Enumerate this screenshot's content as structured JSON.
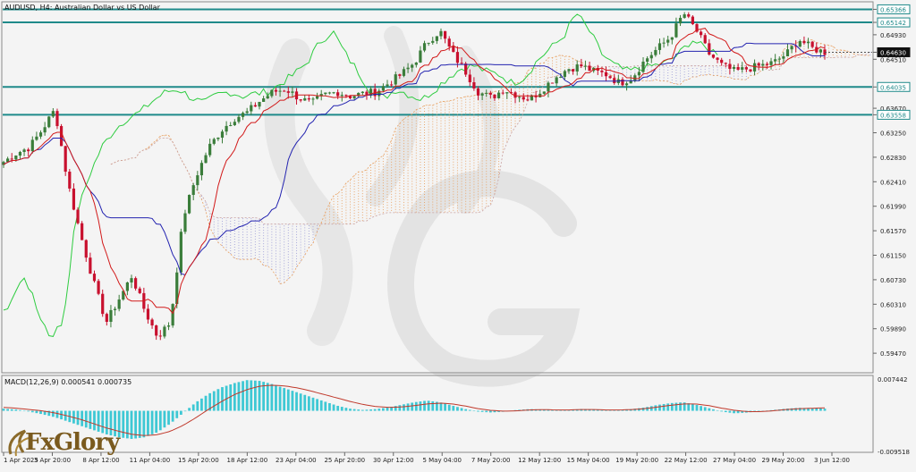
{
  "symbol_title": "AUDUSD, H4:  Australian Dollar vs US Dollar",
  "macd_label": "MACD(12,26,9) 0.000541 0.000735",
  "brand_text": "FxGlory",
  "colors": {
    "background": "#f4f4f4",
    "bull_candle": "#3a7d3a",
    "bear_candle": "#c8102e",
    "tenkan": "#d21a1a",
    "kijun": "#2323b0",
    "chikou": "#2ecc40",
    "cloud_bull": "#e8a060",
    "cloud_bear": "#a0a0d8",
    "level_line": "#1f8a8a",
    "macd_hist": "#3ec8d4",
    "macd_signal": "#c0392b",
    "watermark": "#d9d9d9"
  },
  "chart_data": [
    {
      "type": "candlestick",
      "title": "AUDUSD, H4:  Australian Dollar vs US Dollar",
      "ylim": [
        0.5915,
        0.6548
      ],
      "y_ticks": [
        "0.65366",
        "0.65142",
        "0.64930",
        "0.64630",
        "0.64510",
        "0.64035",
        "0.63670",
        "0.63558",
        "0.63250",
        "0.62830",
        "0.62410",
        "0.61990",
        "0.61570",
        "0.61150",
        "0.60730",
        "0.60310",
        "0.59890",
        "0.59470"
      ],
      "highlighted_ticks": [
        "0.65366",
        "0.65142",
        "0.64630",
        "0.64035",
        "0.63558"
      ],
      "current_price": "0.64630",
      "horizontal_levels": [
        0.65366,
        0.65142,
        0.64035,
        0.63558
      ],
      "x_labels": [
        "1 Apr 2025",
        "3 Apr 20:00",
        "8 Apr 12:00",
        "11 Apr 04:00",
        "15 Apr 20:00",
        "18 Apr 12:00",
        "23 Apr 04:00",
        "25 Apr 20:00",
        "30 Apr 12:00",
        "5 May 04:00",
        "7 May 20:00",
        "12 May 12:00",
        "15 May 04:00",
        "19 May 20:00",
        "22 May 12:00",
        "27 May 04:00",
        "29 May 20:00",
        "3 Jun 12:00"
      ],
      "indicators": [
        "Ichimoku (Tenkan, Kijun, Chikou, Cloud)"
      ],
      "close_path": [
        0.6275,
        0.629,
        0.63,
        0.633,
        0.6365,
        0.624,
        0.615,
        0.607,
        0.6,
        0.604,
        0.608,
        0.602,
        0.5975,
        0.6,
        0.618,
        0.625,
        0.63,
        0.633,
        0.635,
        0.636,
        0.638,
        0.6395,
        0.64,
        0.6385,
        0.6375,
        0.639,
        0.6395,
        0.6388,
        0.6392,
        0.6395,
        0.641,
        0.6425,
        0.6445,
        0.648,
        0.65,
        0.646,
        0.643,
        0.6395,
        0.6385,
        0.64,
        0.639,
        0.6382,
        0.64,
        0.642,
        0.6435,
        0.644,
        0.643,
        0.6425,
        0.641,
        0.642,
        0.645,
        0.647,
        0.649,
        0.653,
        0.65,
        0.646,
        0.644,
        0.643,
        0.6435,
        0.644,
        0.6445,
        0.646,
        0.6485,
        0.647,
        0.6463
      ]
    },
    {
      "type": "bar",
      "title": "MACD(12,26,9) 0.000541 0.000735",
      "macd": 0.000541,
      "signal_value": 0.000735,
      "ylim": [
        -0.009518,
        0.007442
      ],
      "y_ticks": [
        "0.007442",
        "-0.009518"
      ],
      "histogram": [
        0.0005,
        0.0003,
        -0.0002,
        -0.0008,
        -0.0015,
        -0.0025,
        -0.0035,
        -0.0045,
        -0.0055,
        -0.0062,
        -0.0066,
        -0.0062,
        -0.005,
        -0.003,
        -0.0005,
        0.002,
        0.004,
        0.0055,
        0.0065,
        0.0072,
        0.007,
        0.0062,
        0.0052,
        0.0042,
        0.0032,
        0.0022,
        0.0012,
        0.0005,
        0.0002,
        0.0004,
        0.0008,
        0.0014,
        0.002,
        0.0024,
        0.002,
        0.0012,
        0.0004,
        -0.0002,
        -0.0004,
        -0.0002,
        0.0002,
        0.0004,
        0.0003,
        0.0001,
        0.0002,
        0.0004,
        0.0003,
        0.0001,
        0.0002,
        0.0004,
        0.0008,
        0.0014,
        0.0018,
        0.002,
        0.0014,
        0.0006,
        -0.0002,
        -0.0006,
        -0.0004,
        -0.0001,
        0.0002,
        0.0005,
        0.0007,
        0.0006,
        0.0005
      ],
      "signal": [
        0.0008,
        0.0006,
        0.0003,
        0.0,
        -0.0005,
        -0.0012,
        -0.002,
        -0.003,
        -0.004,
        -0.0048,
        -0.0055,
        -0.0058,
        -0.0056,
        -0.0048,
        -0.0034,
        -0.0016,
        0.0004,
        0.0022,
        0.0038,
        0.005,
        0.0058,
        0.006,
        0.0058,
        0.0053,
        0.0046,
        0.0038,
        0.003,
        0.0022,
        0.0015,
        0.001,
        0.0008,
        0.0009,
        0.0012,
        0.0016,
        0.0018,
        0.0016,
        0.0011,
        0.0005,
        0.0001,
        -0.0001,
        0.0,
        0.0002,
        0.0003,
        0.0002,
        0.0002,
        0.0003,
        0.0003,
        0.0002,
        0.0002,
        0.0003,
        0.0005,
        0.0009,
        0.0013,
        0.0016,
        0.0016,
        0.0012,
        0.0006,
        0.0001,
        -0.0002,
        -0.0002,
        0.0,
        0.0003,
        0.0005,
        0.0006,
        0.0007
      ]
    }
  ]
}
